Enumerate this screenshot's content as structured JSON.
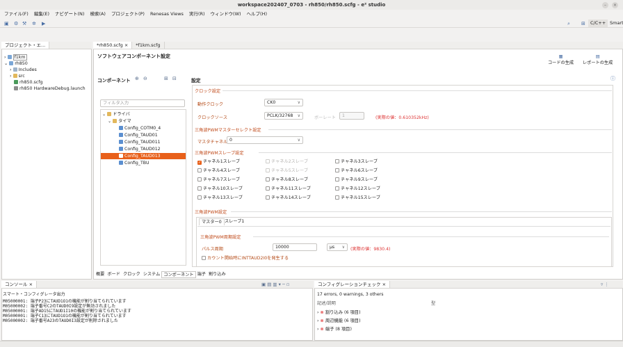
{
  "window": {
    "title": "workspace202407_0703 - rh850/rh850.scfg - e² studio"
  },
  "menu": [
    "ファイル(F)",
    "編集(E)",
    "ナビゲート(N)",
    "検索(A)",
    "プロジェクト(P)",
    "Renesas Views",
    "実行(R)",
    "ウィンドウ(W)",
    "ヘルプ(H)"
  ],
  "toolbar": {
    "perspective1": "C/C++",
    "perspective2": "Smart Configurat"
  },
  "project_explorer": {
    "tab_label": "プロジェクト・エ...",
    "tree": [
      "f1km",
      "rh850",
      "Includes",
      "src",
      "rh850.scfg",
      "rh850 HardwareDebug.launch"
    ]
  },
  "editor": {
    "tabs": [
      "*rh850.scfg",
      "*f1km.scfg"
    ],
    "title": "ソフトウェアコンポーネント設定",
    "gen_code": "コードの生成",
    "gen_report": "レポートの生成",
    "components_label": "コンポーネント",
    "settings_label": "設定",
    "filter_placeholder": "フィルタ入力",
    "component_tree": [
      "ドライバ",
      "タイマ",
      "Config_COTM0_4",
      "Config_TAUD01",
      "Config_TAUD011",
      "Config_TAUD012",
      "Config_TAUD013",
      "Config_TBU"
    ],
    "selected_component": "Config_TAUD013",
    "clock": {
      "section": "クロック設定",
      "op_clock_label": "動作クロック",
      "op_clock_value": "CK0",
      "clock_source_label": "クロックソース",
      "clock_source_value": "PCLK/32768",
      "baud_label": "ボーレート",
      "baud_value": "1",
      "actual_value": "(実際の値：0.610352kHz)"
    },
    "master_select": {
      "section": "三角波PWMマスターセレクト設定",
      "channel_label": "マスタチャネル選択",
      "channel_value": "0"
    },
    "slave": {
      "section": "三角波PWMスレーブ設定",
      "checks": [
        {
          "label": "チャネル1スレーブ",
          "state": "checked"
        },
        {
          "label": "チャネル2スレーブ",
          "state": "disabled"
        },
        {
          "label": "チャネル3スレーブ",
          "state": "normal"
        },
        {
          "label": "チャネル4スレーブ",
          "state": "normal"
        },
        {
          "label": "チャネル5スレーブ",
          "state": "disabled"
        },
        {
          "label": "チャネル6スレーブ",
          "state": "normal"
        },
        {
          "label": "チャネル7スレーブ",
          "state": "normal"
        },
        {
          "label": "チャネル8スレーブ",
          "state": "normal"
        },
        {
          "label": "チャネル9スレーブ",
          "state": "normal"
        },
        {
          "label": "チャネル10スレーブ",
          "state": "normal"
        },
        {
          "label": "チャネル11スレーブ",
          "state": "normal"
        },
        {
          "label": "チャネル12スレーブ",
          "state": "normal"
        },
        {
          "label": "チャネル13スレーブ",
          "state": "normal"
        },
        {
          "label": "チャネル14スレーブ",
          "state": "normal"
        },
        {
          "label": "チャネル15スレーブ",
          "state": "normal"
        }
      ]
    },
    "pwm": {
      "section": "三角波PWM設定",
      "tab_master": "マスター0",
      "tab_slave": "スレーブ1",
      "period_section": "三角波PWM周期設定",
      "pulse_label": "パルス周期",
      "pulse_value": "10000",
      "unit_value": "μs",
      "actual_value": "(実際の値：9830.4)",
      "interrupt_label": "カウント開始時にINTTAUD2I0を発生する"
    },
    "bottom_tabs": [
      "概要",
      "ボード",
      "クロック",
      "システム",
      "コンポーネント",
      "端子",
      "割り込み"
    ]
  },
  "console": {
    "tab_label": "コンソール",
    "title": "スマート・コンフィグレータ出力",
    "lines": [
      "M05000001: 端子P23にTAUD1O1の機能が割り当てられています",
      "M05000002: 端子番号C2のTAUD0I9設定が無効されました",
      "M05000001: 端子AD15にTAUD1I10の機能が割り当てられています",
      "M05000001: 端子C13にTAUD1O1の機能が割り当てられています",
      "M05000002: 端子番号A23のTAUD0I3設定が削除されました"
    ]
  },
  "config_check": {
    "tab_label": "コンフィグレーションチェック",
    "summary": "17 errors, 0 warnings, 3 others",
    "col_desc": "記述/説明",
    "col_type": "型",
    "items": [
      "割り込み (6 項目)",
      "周辺機能 (6 項目)",
      "端子 (8 項目)"
    ]
  },
  "colors": {
    "accent": "#e8601a",
    "label": "#b44a16",
    "error": "#d22"
  }
}
